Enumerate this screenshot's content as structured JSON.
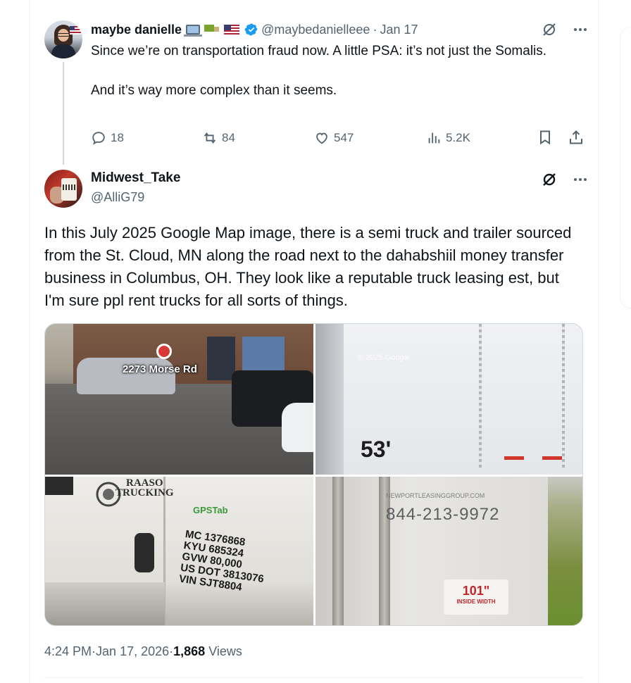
{
  "tweet1": {
    "name": "maybe danielle",
    "handle": "@maybedanielleee",
    "separator": " · ",
    "date": "Jan 17",
    "text": "Since we’re on transportation fraud now. A little PSA: it’s not just the Somalis.\n\nAnd it’s way more complex than it seems.",
    "stats": {
      "replies": "18",
      "reposts": "84",
      "likes": "547",
      "views": "5.2K"
    },
    "emojis": [
      "laptop-emoji",
      "truck-emoji",
      "us-flag-emoji"
    ]
  },
  "tweet2": {
    "name": "Midwest_Take",
    "handle": "@AlliG79",
    "text": "In this July 2025 Google Map image, there is a semi truck and trailer sourced from the St. Cloud, MN along the road next to the dahabshiil money transfer business in Columbus, OH. They look like a reputable truck leasing est, but I'm sure ppl rent trucks for all sorts of things.",
    "media": {
      "map_label": "2273 Morse Rd",
      "trailer_number": "53'",
      "trailer_watermark": "© 2025 Google",
      "brand_lines": "RAASO\nTRUCKING",
      "gps_label": "GPSTab",
      "dot_lines": "MC 1376868\nKYU 685324\nGVW 80,000\nUS DOT 3813076\nVIN SJT8804",
      "phone": "844-213-9972",
      "url": "NEWPORTLEASINGGROUP.COM",
      "placard_value": "101\"",
      "placard_label": "INSIDE WIDTH"
    },
    "time": "4:24 PM",
    "date": "Jan 17, 2026",
    "views_count": "1,868",
    "views_label": " Views",
    "dot": " · "
  },
  "colors": {
    "text": "#0f1419",
    "dim": "#536471",
    "verified": "#1d9bf0"
  }
}
